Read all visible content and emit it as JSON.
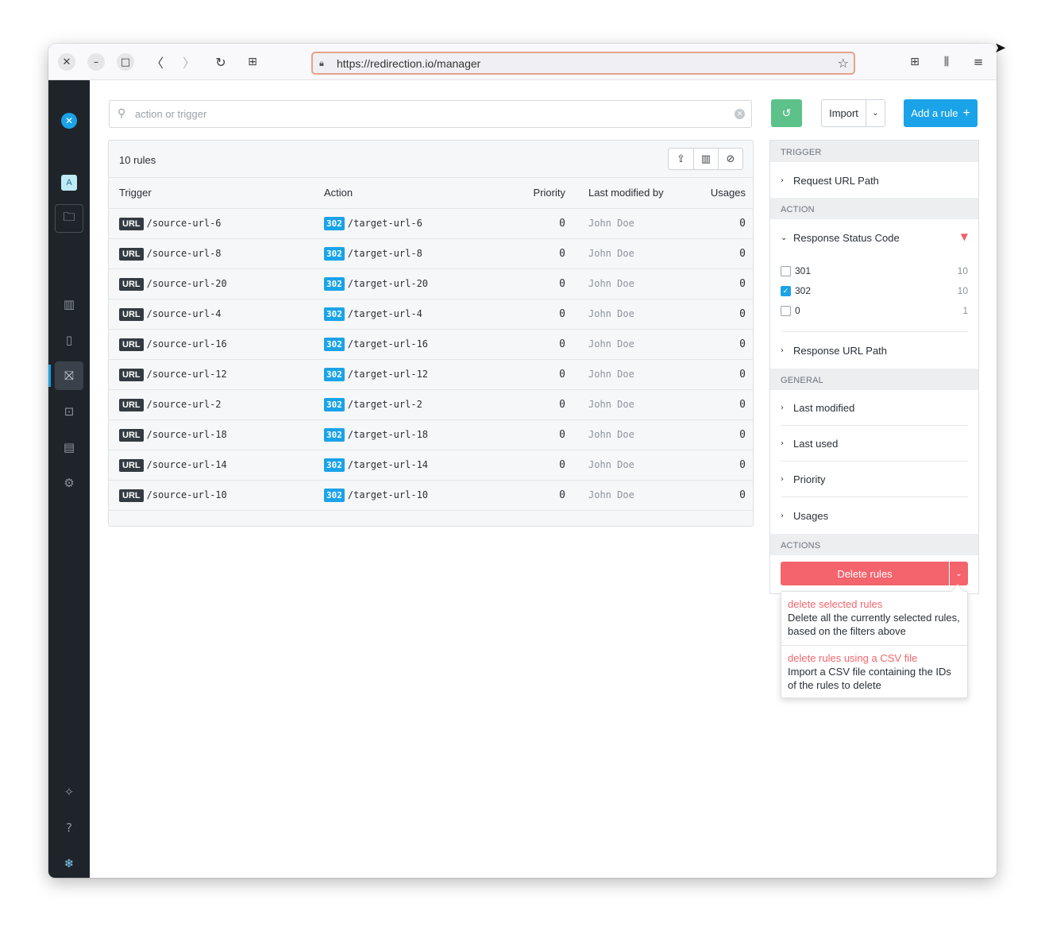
{
  "browser": {
    "url": "https://redirection.io/manager"
  },
  "sidebar": {
    "logo": "✕",
    "project_initial": "A"
  },
  "search": {
    "placeholder": "action or trigger"
  },
  "table": {
    "count_label": "10 rules",
    "columns": [
      "Trigger",
      "Action",
      "Priority",
      "Last modified by",
      "Usages"
    ],
    "rows": [
      {
        "trigger_tag": "URL",
        "trigger": "/source-url-6",
        "action_tag": "302",
        "action": "/target-url-6",
        "priority": "0",
        "by": "John Doe",
        "usages": "0"
      },
      {
        "trigger_tag": "URL",
        "trigger": "/source-url-8",
        "action_tag": "302",
        "action": "/target-url-8",
        "priority": "0",
        "by": "John Doe",
        "usages": "0"
      },
      {
        "trigger_tag": "URL",
        "trigger": "/source-url-20",
        "action_tag": "302",
        "action": "/target-url-20",
        "priority": "0",
        "by": "John Doe",
        "usages": "0"
      },
      {
        "trigger_tag": "URL",
        "trigger": "/source-url-4",
        "action_tag": "302",
        "action": "/target-url-4",
        "priority": "0",
        "by": "John Doe",
        "usages": "0"
      },
      {
        "trigger_tag": "URL",
        "trigger": "/source-url-16",
        "action_tag": "302",
        "action": "/target-url-16",
        "priority": "0",
        "by": "John Doe",
        "usages": "0"
      },
      {
        "trigger_tag": "URL",
        "trigger": "/source-url-12",
        "action_tag": "302",
        "action": "/target-url-12",
        "priority": "0",
        "by": "John Doe",
        "usages": "0"
      },
      {
        "trigger_tag": "URL",
        "trigger": "/source-url-2",
        "action_tag": "302",
        "action": "/target-url-2",
        "priority": "0",
        "by": "John Doe",
        "usages": "0"
      },
      {
        "trigger_tag": "URL",
        "trigger": "/source-url-18",
        "action_tag": "302",
        "action": "/target-url-18",
        "priority": "0",
        "by": "John Doe",
        "usages": "0"
      },
      {
        "trigger_tag": "URL",
        "trigger": "/source-url-14",
        "action_tag": "302",
        "action": "/target-url-14",
        "priority": "0",
        "by": "John Doe",
        "usages": "0"
      },
      {
        "trigger_tag": "URL",
        "trigger": "/source-url-10",
        "action_tag": "302",
        "action": "/target-url-10",
        "priority": "0",
        "by": "John Doe",
        "usages": "0"
      }
    ]
  },
  "buttons": {
    "import": "Import",
    "add_rule": "Add a rule",
    "add_rule_icon": "+"
  },
  "filters": {
    "trigger_header": "Trigger",
    "request_url_path": "Request URL Path",
    "action_header": "Action",
    "response_status_code": "Response Status Code",
    "status_options": [
      {
        "label": "301",
        "count": "10",
        "checked": false
      },
      {
        "label": "302",
        "count": "10",
        "checked": true
      },
      {
        "label": "0",
        "count": "1",
        "checked": false
      }
    ],
    "response_url_path": "Response URL Path",
    "general_header": "General",
    "last_modified": "Last modified",
    "last_used": "Last used",
    "priority": "Priority",
    "usages": "Usages",
    "actions_header": "Actions"
  },
  "delete": {
    "label": "Delete rules",
    "menu": [
      {
        "title": "delete selected rules",
        "desc": "Delete all the currently selected rules, based on the filters above"
      },
      {
        "title": "delete rules using a CSV file",
        "desc": "Import a CSV file containing the IDs of the rules to delete"
      }
    ]
  },
  "colors": {
    "accent": "#1aa3e8",
    "danger": "#f4646c",
    "success": "#5cc28a",
    "sidebar": "#1f242b"
  }
}
